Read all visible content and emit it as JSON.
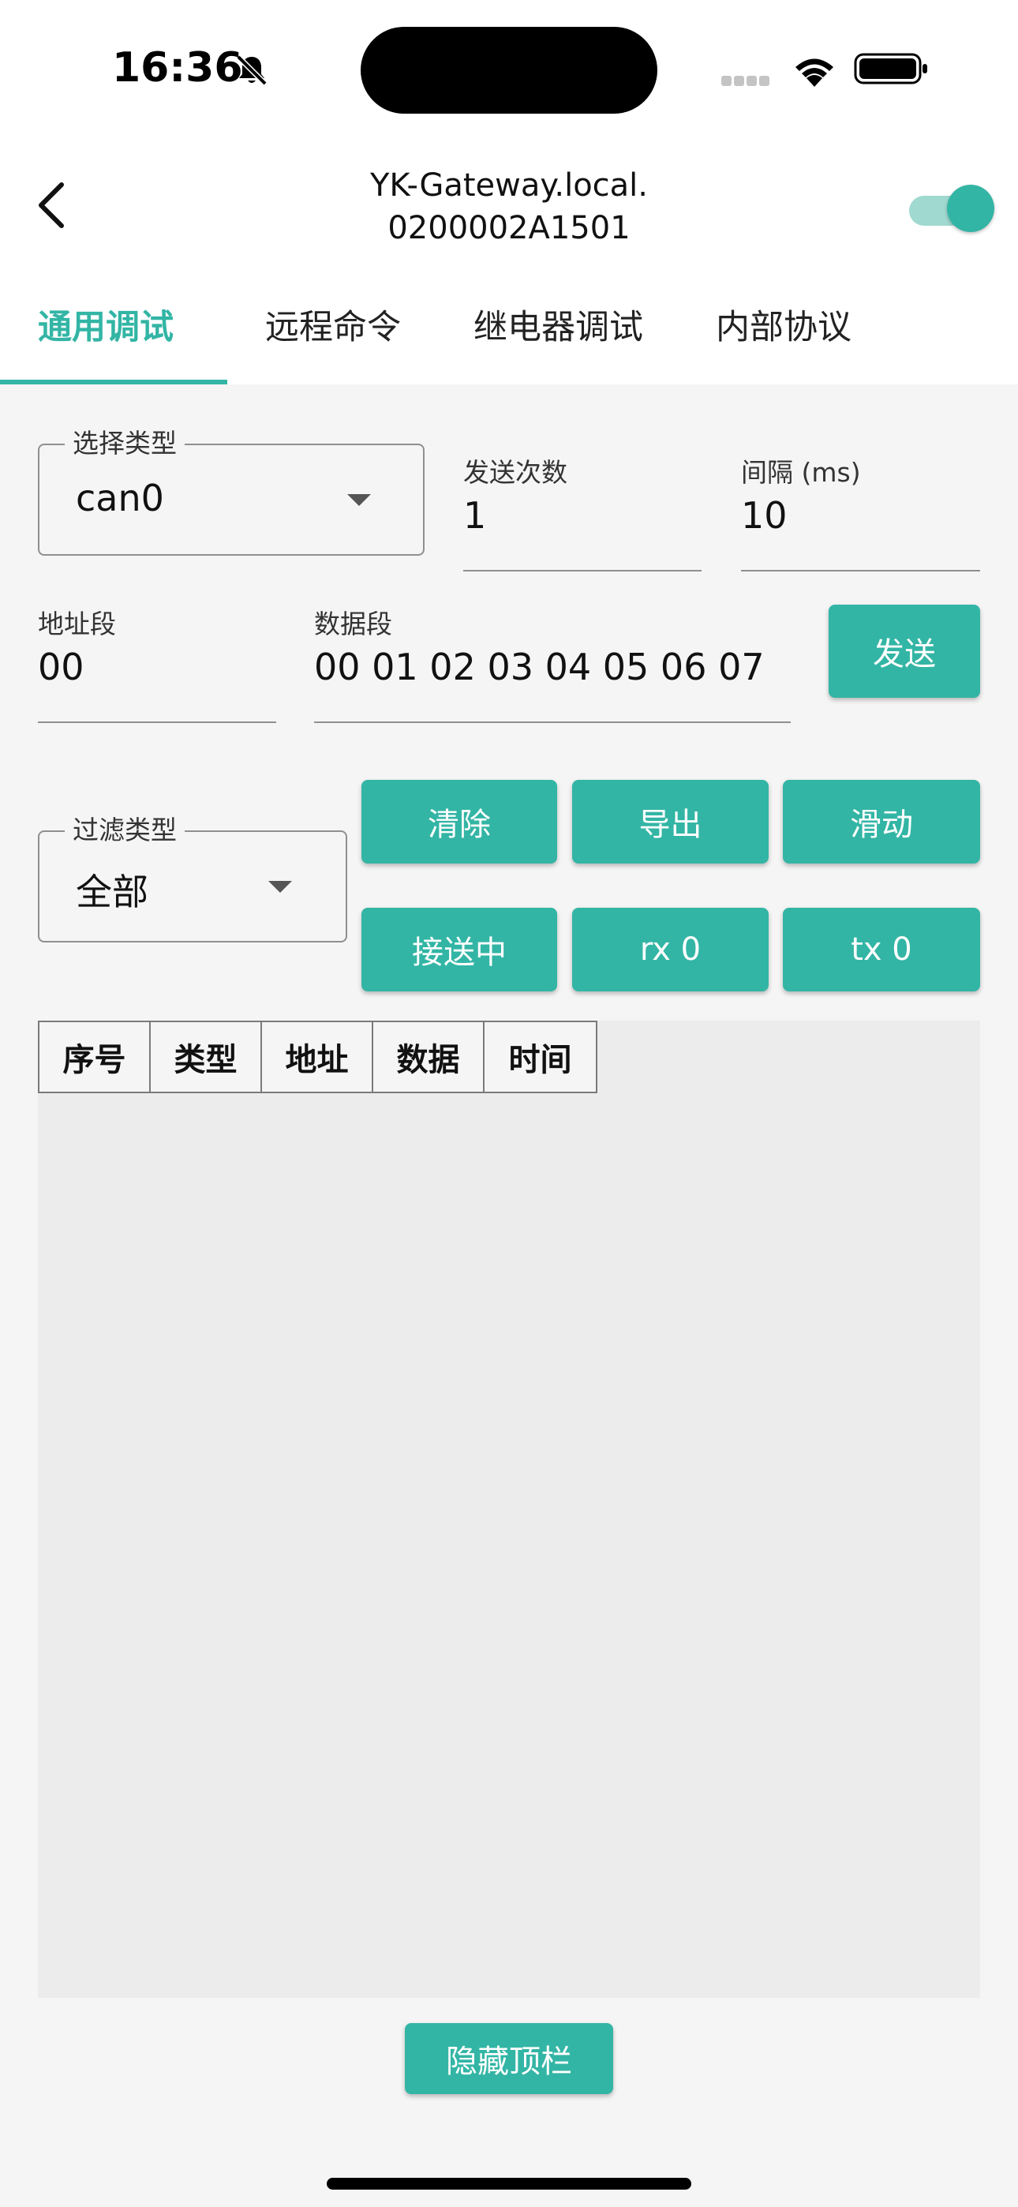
{
  "status_bar": {
    "time": "16:36"
  },
  "app_bar": {
    "title_line1": "YK-Gateway.local.",
    "title_line2": "0200002A1501",
    "toggle_on": true
  },
  "tabs": [
    {
      "label": "通用调试",
      "active": true
    },
    {
      "label": "远程命令",
      "active": false
    },
    {
      "label": "继电器调试",
      "active": false
    },
    {
      "label": "内部协议",
      "active": false
    }
  ],
  "form": {
    "select_type": {
      "label": "选择类型",
      "value": "can0"
    },
    "send_count": {
      "label": "发送次数",
      "value": "1"
    },
    "interval": {
      "label": "间隔 (ms)",
      "value": "10"
    },
    "address": {
      "label": "地址段",
      "value": "00"
    },
    "data": {
      "label": "数据段",
      "value": "00 01 02 03 04 05 06 07"
    },
    "send_button": "发送",
    "filter_type": {
      "label": "过滤类型",
      "value": "全部"
    }
  },
  "actions": {
    "clear": "清除",
    "export": "导出",
    "scroll": "滑动",
    "receiving": "接送中",
    "rx": "rx 0",
    "tx": "tx 0"
  },
  "table": {
    "headers": [
      "序号",
      "类型",
      "地址",
      "数据",
      "时间"
    ],
    "rows": []
  },
  "hide_topbar_button": "隐藏顶栏",
  "colors": {
    "accent": "#33b5a5",
    "background": "#f5f5f5",
    "panel": "#ececec"
  }
}
